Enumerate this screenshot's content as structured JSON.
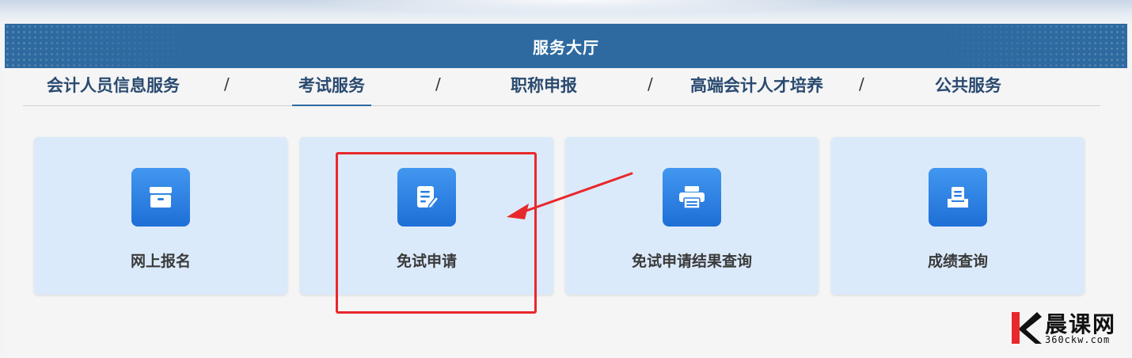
{
  "hall": {
    "title": "服务大厅"
  },
  "tabs": [
    {
      "label": "会计人员信息服务",
      "active": false
    },
    {
      "label": "考试服务",
      "active": true
    },
    {
      "label": "职称申报",
      "active": false
    },
    {
      "label": "高端会计人才培养",
      "active": false
    },
    {
      "label": "公共服务",
      "active": false
    }
  ],
  "separator": "/",
  "cards": [
    {
      "label": "网上报名",
      "icon": "archive-box-icon"
    },
    {
      "label": "免试申请",
      "icon": "document-edit-icon"
    },
    {
      "label": "免试申请结果查询",
      "icon": "printer-icon"
    },
    {
      "label": "成绩查询",
      "icon": "inbox-tray-icon"
    }
  ],
  "annotation": {
    "box_color": "#e8282b",
    "arrow_color": "#e8282b"
  },
  "colors": {
    "header": "#2e6aa0",
    "card_bg": "#dbeafb",
    "icon_blue": "#2a7fe4",
    "tab_text": "#2a4a70"
  },
  "watermark": {
    "brand": "晨课网",
    "url": "360ckw.com"
  }
}
